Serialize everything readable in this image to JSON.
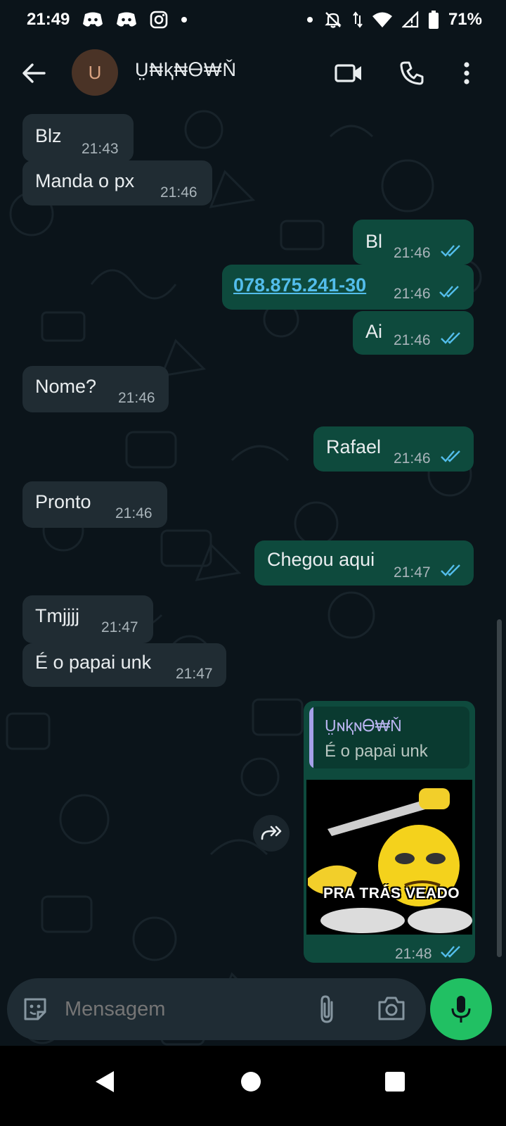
{
  "status_bar": {
    "time": "21:49",
    "battery": "71%",
    "notification_icons": [
      "discord-icon",
      "discord-icon",
      "instagram-icon",
      "dot-icon"
    ],
    "system_icons": [
      "dot-icon",
      "mute-icon",
      "data-arrows-icon",
      "wifi-icon",
      "signal-icon",
      "battery-icon"
    ]
  },
  "header": {
    "avatar_initial": "U",
    "contact_name": "Ṳ₦ⱪ₦Ꮎ₩Ň",
    "icons": [
      "back-arrow-icon",
      "video-call-icon",
      "phone-call-icon",
      "more-vert-icon"
    ]
  },
  "messages": [
    {
      "dir": "in",
      "text": "Blz",
      "time": "21:43"
    },
    {
      "dir": "in",
      "text": "Manda o px",
      "time": "21:46"
    },
    {
      "dir": "out",
      "text": "Bl",
      "time": "21:46"
    },
    {
      "dir": "out",
      "text": "078.875.241-30",
      "time": "21:46",
      "link": true
    },
    {
      "dir": "out",
      "text": "Ai",
      "time": "21:46"
    },
    {
      "dir": "in",
      "text": "Nome?",
      "time": "21:46"
    },
    {
      "dir": "out",
      "text": "Rafael",
      "time": "21:46"
    },
    {
      "dir": "in",
      "text": "Pronto",
      "time": "21:46"
    },
    {
      "dir": "out",
      "text": "Chegou aqui",
      "time": "21:47"
    },
    {
      "dir": "in",
      "text": "Tmjjjj",
      "time": "21:47"
    },
    {
      "dir": "in",
      "text": "É o papai unk",
      "time": "21:47"
    }
  ],
  "sticker_message": {
    "quoted_author": "ṲɴⱪɴᎾ₩Ň",
    "quoted_text": "É o papai unk",
    "sticker_caption": "PRA TRÁS VEADO",
    "time": "21:48"
  },
  "composer": {
    "placeholder": "Mensagem",
    "icons": [
      "sticker-icon",
      "attach-icon",
      "camera-icon",
      "mic-icon"
    ]
  },
  "nav_bar": {
    "icons": [
      "nav-back-icon",
      "nav-home-icon",
      "nav-recents-icon"
    ]
  },
  "colors": {
    "background": "#0b141a",
    "incoming_bubble": "#202c33",
    "outgoing_bubble": "#0e4a3d",
    "accent_green": "#21c063",
    "read_ticks": "#53bdeb",
    "link": "#53bdeb"
  }
}
